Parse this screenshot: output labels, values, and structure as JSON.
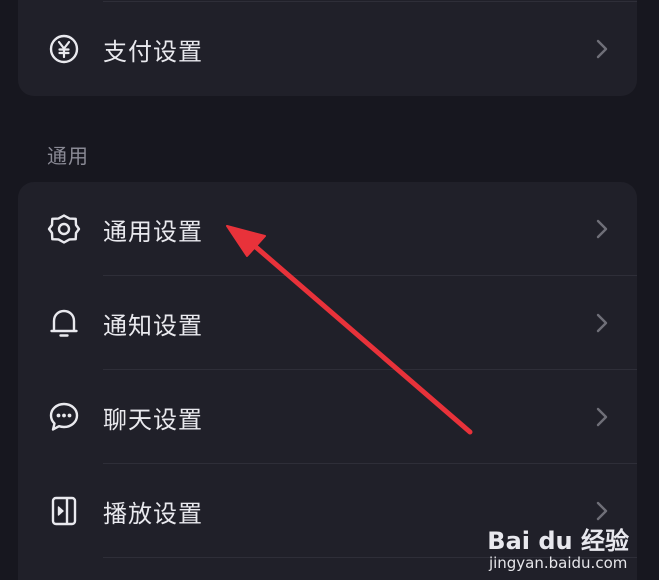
{
  "payment_card": {
    "item": {
      "label": "支付设置",
      "icon": "yen-circle-icon"
    }
  },
  "general_section": {
    "title": "通用",
    "items": [
      {
        "label": "通用设置",
        "icon": "gear-icon"
      },
      {
        "label": "通知设置",
        "icon": "bell-icon"
      },
      {
        "label": "聊天设置",
        "icon": "chat-bubble-icon"
      },
      {
        "label": "播放设置",
        "icon": "play-device-icon"
      }
    ]
  },
  "annotation": {
    "arrow_color": "#e8323a"
  },
  "watermark": {
    "logo": "Bai du 经验",
    "url": "jingyan.baidu.com"
  },
  "colors": {
    "background": "#17171f",
    "card": "#202029",
    "text": "#e9e9ee",
    "section_title": "#8a8a95",
    "chevron": "#6f6f78"
  }
}
